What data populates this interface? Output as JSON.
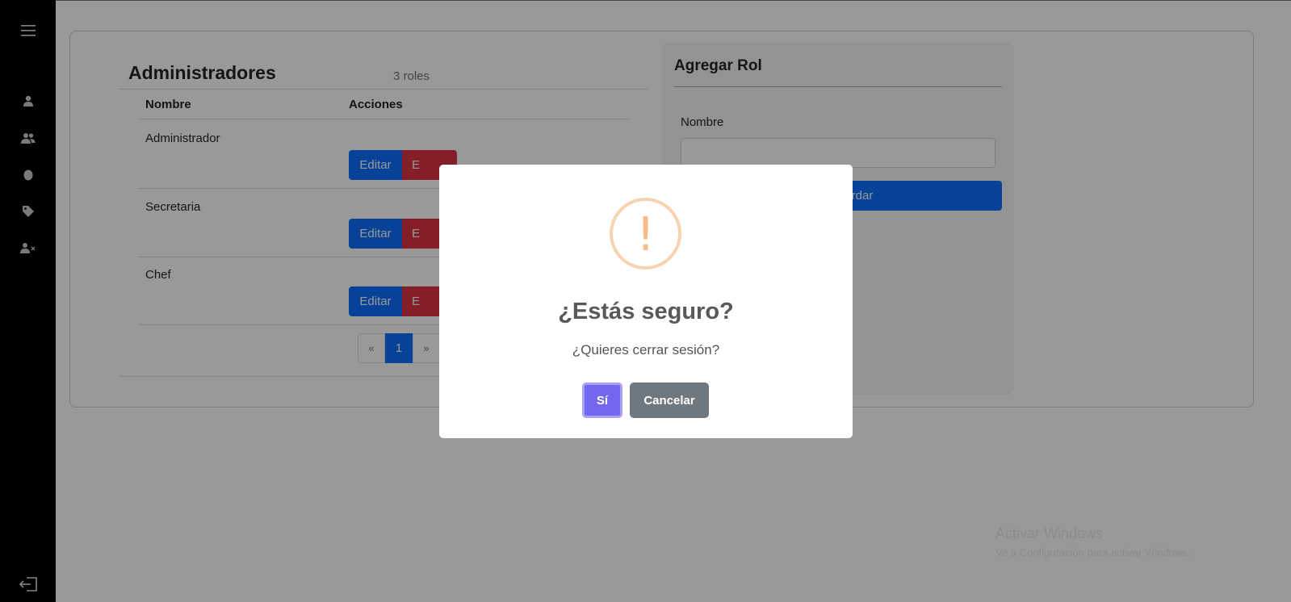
{
  "sidebar": {
    "icons": [
      "menu-icon",
      "user-icon",
      "users-icon",
      "egg-icon",
      "tag-icon",
      "user-x-icon",
      "logout-icon"
    ]
  },
  "list": {
    "title": "Administradores",
    "count": "3 roles",
    "headers": {
      "name": "Nombre",
      "actions": "Acciones"
    },
    "rows": [
      {
        "name": "Administrador",
        "edit": "Editar",
        "delete": "E"
      },
      {
        "name": "Secretaria",
        "edit": "Editar",
        "delete": "E"
      },
      {
        "name": "Chef",
        "edit": "Editar",
        "delete": "E"
      }
    ],
    "pagination": {
      "prev": "«",
      "current": "1",
      "next": "»"
    }
  },
  "form": {
    "title": "Agregar Rol",
    "name_label": "Nombre",
    "save_label": "rdar"
  },
  "watermark": {
    "line1": "Activar Windows",
    "line2": "Ve a Configuración para activar Windows."
  },
  "dialog": {
    "icon": "!",
    "title": "¿Estás seguro?",
    "text": "¿Quieres cerrar sesión?",
    "confirm": "Sí",
    "cancel": "Cancelar"
  },
  "colors": {
    "primary": "#0d6efd",
    "danger": "#dc3545",
    "confirm": "#7367f0",
    "cancel": "#6e7881",
    "warning": "#f8bb86"
  }
}
